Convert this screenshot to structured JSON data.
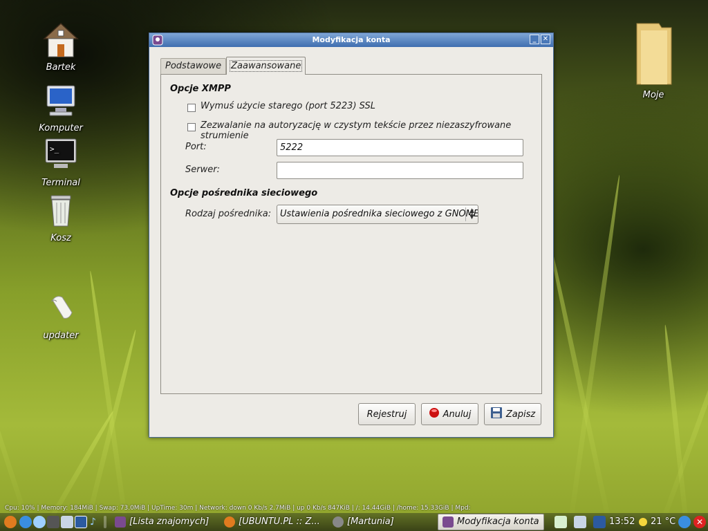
{
  "desktop": {
    "icons": [
      {
        "label": "Bartek"
      },
      {
        "label": "Komputer"
      },
      {
        "label": "Terminal"
      },
      {
        "label": "Kosz"
      },
      {
        "label": "updater"
      },
      {
        "label": "Moje"
      }
    ]
  },
  "dialog": {
    "title": "Modyfikacja konta",
    "tabs": [
      {
        "label": "Podstawowe"
      },
      {
        "label": "Zaawansowane",
        "active": true
      }
    ],
    "xmpp": {
      "heading": "Opcje XMPP",
      "force_old_ssl": {
        "label": "Wymuś użycie starego (port 5223) SSL",
        "checked": false
      },
      "plaintext_auth": {
        "label": "Zezwalanie na autoryzację w czystym tekście przez niezaszyfrowane strumienie",
        "checked": false
      },
      "port_label": "Port:",
      "port_value": "5222",
      "server_label": "Serwer:",
      "server_value": ""
    },
    "proxy": {
      "heading": "Opcje pośrednika sieciowego",
      "type_label": "Rodzaj pośrednika:",
      "type_value": "Ustawienia pośrednika sieciowego z GNOME"
    },
    "buttons": {
      "register": "Rejestruj",
      "cancel": "Anuluj",
      "save": "Zapisz"
    }
  },
  "conky": {
    "text": "Cpu: 10% | Memory: 184MiB | Swap: 73.0MiB | UpTime: 30m | Network: down 0 Kb/s  2.7MiB  | up 0 Kb/s  847KiB  | /: 14.44GiB | /home: 15.33GiB | Mpd:"
  },
  "taskbar": {
    "tasks": [
      {
        "label": "[Lista znajomych]"
      },
      {
        "label": "[UBUNTU.PL :: Z..."
      },
      {
        "label": "[Martunia]"
      },
      {
        "label": "Modyfikacja konta",
        "active": true
      }
    ],
    "clock": "13:52",
    "weather": "21 °C"
  },
  "colors": {
    "titlebar": "#3f6eb0",
    "dialog_bg": "#edebe6",
    "cancel_icon": "#cc1111"
  }
}
